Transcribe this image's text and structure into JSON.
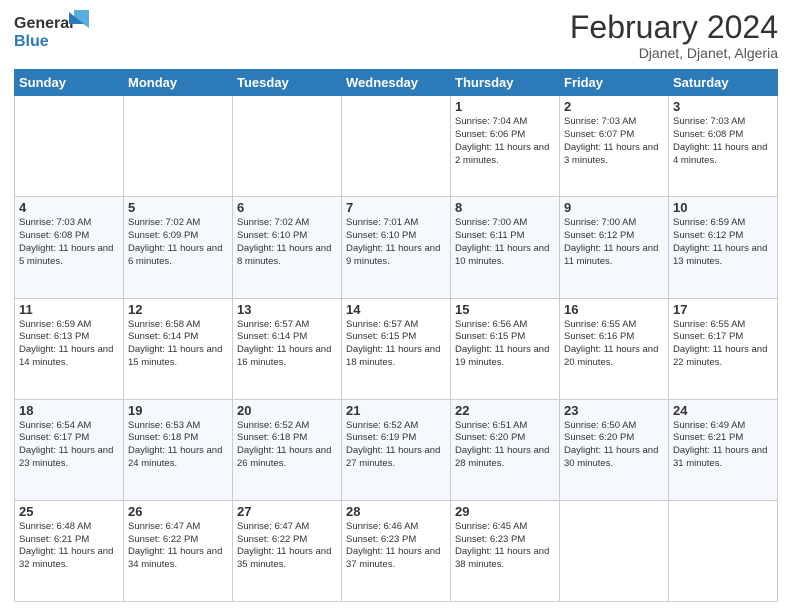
{
  "header": {
    "logo_line1": "General",
    "logo_line2": "Blue",
    "month": "February 2024",
    "location": "Djanet, Djanet, Algeria"
  },
  "days_of_week": [
    "Sunday",
    "Monday",
    "Tuesday",
    "Wednesday",
    "Thursday",
    "Friday",
    "Saturday"
  ],
  "weeks": [
    [
      {
        "num": "",
        "info": ""
      },
      {
        "num": "",
        "info": ""
      },
      {
        "num": "",
        "info": ""
      },
      {
        "num": "",
        "info": ""
      },
      {
        "num": "1",
        "info": "Sunrise: 7:04 AM\nSunset: 6:06 PM\nDaylight: 11 hours and 2 minutes."
      },
      {
        "num": "2",
        "info": "Sunrise: 7:03 AM\nSunset: 6:07 PM\nDaylight: 11 hours and 3 minutes."
      },
      {
        "num": "3",
        "info": "Sunrise: 7:03 AM\nSunset: 6:08 PM\nDaylight: 11 hours and 4 minutes."
      }
    ],
    [
      {
        "num": "4",
        "info": "Sunrise: 7:03 AM\nSunset: 6:08 PM\nDaylight: 11 hours and 5 minutes."
      },
      {
        "num": "5",
        "info": "Sunrise: 7:02 AM\nSunset: 6:09 PM\nDaylight: 11 hours and 6 minutes."
      },
      {
        "num": "6",
        "info": "Sunrise: 7:02 AM\nSunset: 6:10 PM\nDaylight: 11 hours and 8 minutes."
      },
      {
        "num": "7",
        "info": "Sunrise: 7:01 AM\nSunset: 6:10 PM\nDaylight: 11 hours and 9 minutes."
      },
      {
        "num": "8",
        "info": "Sunrise: 7:00 AM\nSunset: 6:11 PM\nDaylight: 11 hours and 10 minutes."
      },
      {
        "num": "9",
        "info": "Sunrise: 7:00 AM\nSunset: 6:12 PM\nDaylight: 11 hours and 11 minutes."
      },
      {
        "num": "10",
        "info": "Sunrise: 6:59 AM\nSunset: 6:12 PM\nDaylight: 11 hours and 13 minutes."
      }
    ],
    [
      {
        "num": "11",
        "info": "Sunrise: 6:59 AM\nSunset: 6:13 PM\nDaylight: 11 hours and 14 minutes."
      },
      {
        "num": "12",
        "info": "Sunrise: 6:58 AM\nSunset: 6:14 PM\nDaylight: 11 hours and 15 minutes."
      },
      {
        "num": "13",
        "info": "Sunrise: 6:57 AM\nSunset: 6:14 PM\nDaylight: 11 hours and 16 minutes."
      },
      {
        "num": "14",
        "info": "Sunrise: 6:57 AM\nSunset: 6:15 PM\nDaylight: 11 hours and 18 minutes."
      },
      {
        "num": "15",
        "info": "Sunrise: 6:56 AM\nSunset: 6:15 PM\nDaylight: 11 hours and 19 minutes."
      },
      {
        "num": "16",
        "info": "Sunrise: 6:55 AM\nSunset: 6:16 PM\nDaylight: 11 hours and 20 minutes."
      },
      {
        "num": "17",
        "info": "Sunrise: 6:55 AM\nSunset: 6:17 PM\nDaylight: 11 hours and 22 minutes."
      }
    ],
    [
      {
        "num": "18",
        "info": "Sunrise: 6:54 AM\nSunset: 6:17 PM\nDaylight: 11 hours and 23 minutes."
      },
      {
        "num": "19",
        "info": "Sunrise: 6:53 AM\nSunset: 6:18 PM\nDaylight: 11 hours and 24 minutes."
      },
      {
        "num": "20",
        "info": "Sunrise: 6:52 AM\nSunset: 6:18 PM\nDaylight: 11 hours and 26 minutes."
      },
      {
        "num": "21",
        "info": "Sunrise: 6:52 AM\nSunset: 6:19 PM\nDaylight: 11 hours and 27 minutes."
      },
      {
        "num": "22",
        "info": "Sunrise: 6:51 AM\nSunset: 6:20 PM\nDaylight: 11 hours and 28 minutes."
      },
      {
        "num": "23",
        "info": "Sunrise: 6:50 AM\nSunset: 6:20 PM\nDaylight: 11 hours and 30 minutes."
      },
      {
        "num": "24",
        "info": "Sunrise: 6:49 AM\nSunset: 6:21 PM\nDaylight: 11 hours and 31 minutes."
      }
    ],
    [
      {
        "num": "25",
        "info": "Sunrise: 6:48 AM\nSunset: 6:21 PM\nDaylight: 11 hours and 32 minutes."
      },
      {
        "num": "26",
        "info": "Sunrise: 6:47 AM\nSunset: 6:22 PM\nDaylight: 11 hours and 34 minutes."
      },
      {
        "num": "27",
        "info": "Sunrise: 6:47 AM\nSunset: 6:22 PM\nDaylight: 11 hours and 35 minutes."
      },
      {
        "num": "28",
        "info": "Sunrise: 6:46 AM\nSunset: 6:23 PM\nDaylight: 11 hours and 37 minutes."
      },
      {
        "num": "29",
        "info": "Sunrise: 6:45 AM\nSunset: 6:23 PM\nDaylight: 11 hours and 38 minutes."
      },
      {
        "num": "",
        "info": ""
      },
      {
        "num": "",
        "info": ""
      }
    ]
  ]
}
